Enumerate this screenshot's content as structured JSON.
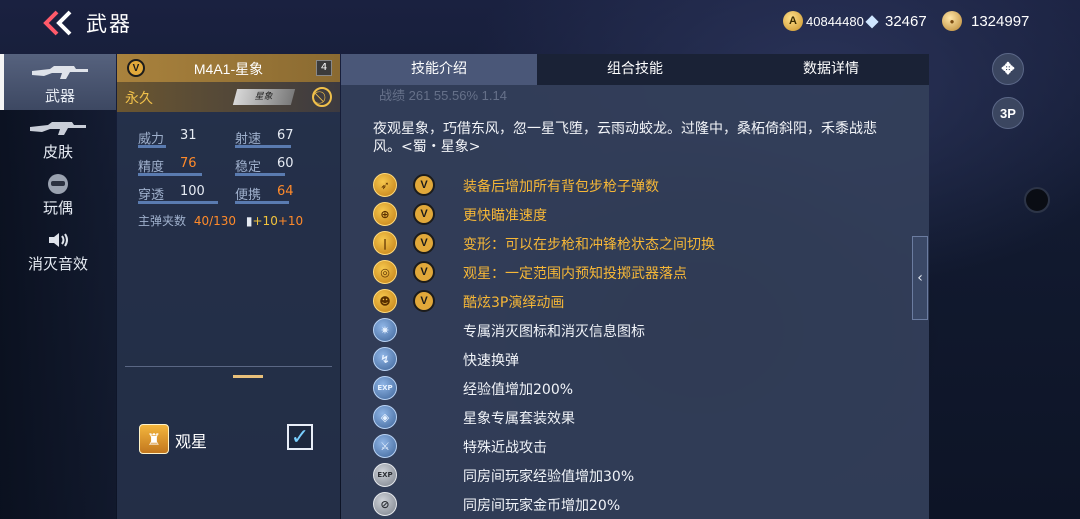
{
  "header": {
    "title": "武器",
    "currencies": [
      {
        "icon": "gold-a-icon",
        "glyph": "A",
        "value": "40844480"
      },
      {
        "icon": "diamond-icon",
        "glyph": "◆",
        "value": "32467"
      },
      {
        "icon": "coin-icon",
        "glyph": "●",
        "value": "1324997"
      }
    ]
  },
  "right_buttons": {
    "top_icon": "✥",
    "view_label": "3P"
  },
  "sidebar": {
    "items": [
      {
        "label": "武器",
        "icon": "rifle-icon"
      },
      {
        "label": "皮肤",
        "icon": "rifle-skin-icon"
      },
      {
        "label": "玩偶",
        "icon": "doll-icon"
      },
      {
        "label": "消灭音效",
        "icon": "speaker-icon"
      }
    ]
  },
  "weapon": {
    "badge": "V",
    "name": "M4A1-星象",
    "level": "4",
    "duration": "永久",
    "skin_tag": "星象",
    "stats": [
      {
        "label": "威力",
        "value": "31",
        "highlight": false
      },
      {
        "label": "射速",
        "value": "67",
        "highlight": false
      },
      {
        "label": "精度",
        "value": "76",
        "highlight": true
      },
      {
        "label": "稳定",
        "value": "60",
        "highlight": false
      },
      {
        "label": "穿透",
        "value": "100",
        "highlight": false
      },
      {
        "label": "便携",
        "value": "64",
        "highlight": true
      }
    ],
    "ammo_label": "主弹夹数",
    "ammo_value": "40/130",
    "ammo_bonus_1": "+10",
    "ammo_bonus_2": "+10",
    "option_label": "观星",
    "option_checked": true
  },
  "tabs": [
    {
      "label": "技能介绍",
      "active": true
    },
    {
      "label": "组合技能",
      "active": false
    },
    {
      "label": "数据详情",
      "active": false
    }
  ],
  "ghost_row": "战绩  261     55.56%     1.14",
  "description": "夜观星象，巧借东风，忽一星飞堕，云雨动蛟龙。过隆中，桑柘倚斜阳，禾黍战悲风。<蜀・星象>",
  "features": [
    {
      "icon": "bullet-icon",
      "glyph": "➶",
      "style": "gold",
      "v": true,
      "text": "装备后增加所有背包步枪子弹数"
    },
    {
      "icon": "crosshair-icon",
      "glyph": "⊕",
      "style": "gold",
      "v": true,
      "text": "更快瞄准速度"
    },
    {
      "icon": "transform-icon",
      "glyph": "|",
      "style": "gold",
      "v": true,
      "text": "变形：可以在步枪和冲锋枪状态之间切换"
    },
    {
      "icon": "star-watch-icon",
      "glyph": "◎",
      "style": "gold",
      "v": true,
      "text": "观星：一定范围内预知投掷武器落点"
    },
    {
      "icon": "character-icon",
      "glyph": "☻",
      "style": "gold",
      "v": true,
      "text": "酷炫3P演绎动画"
    },
    {
      "icon": "kill-icon",
      "glyph": "✷",
      "style": "blue",
      "v": false,
      "text": "专属消灭图标和消灭信息图标"
    },
    {
      "icon": "reload-icon",
      "glyph": "↯",
      "style": "blue",
      "v": false,
      "text": "快速换弹"
    },
    {
      "icon": "exp-icon",
      "glyph": "EXP",
      "style": "blue",
      "v": false,
      "text": "经验值增加200%"
    },
    {
      "icon": "suit-icon",
      "glyph": "◈",
      "style": "blue",
      "v": false,
      "text": "星象专属套装效果"
    },
    {
      "icon": "melee-icon",
      "glyph": "⚔",
      "style": "blue",
      "v": false,
      "text": "特殊近战攻击"
    },
    {
      "icon": "room-exp-icon",
      "glyph": "EXP",
      "style": "grey",
      "v": false,
      "text": "同房间玩家经验值增加30%"
    },
    {
      "icon": "room-coin-icon",
      "glyph": "⊘",
      "style": "grey",
      "v": false,
      "text": "同房间玩家金币增加20%"
    }
  ],
  "colors": {
    "gold_text": "#f6b737",
    "orange_value": "#ff8a2a",
    "accent_bar": "#5a7bb0"
  }
}
